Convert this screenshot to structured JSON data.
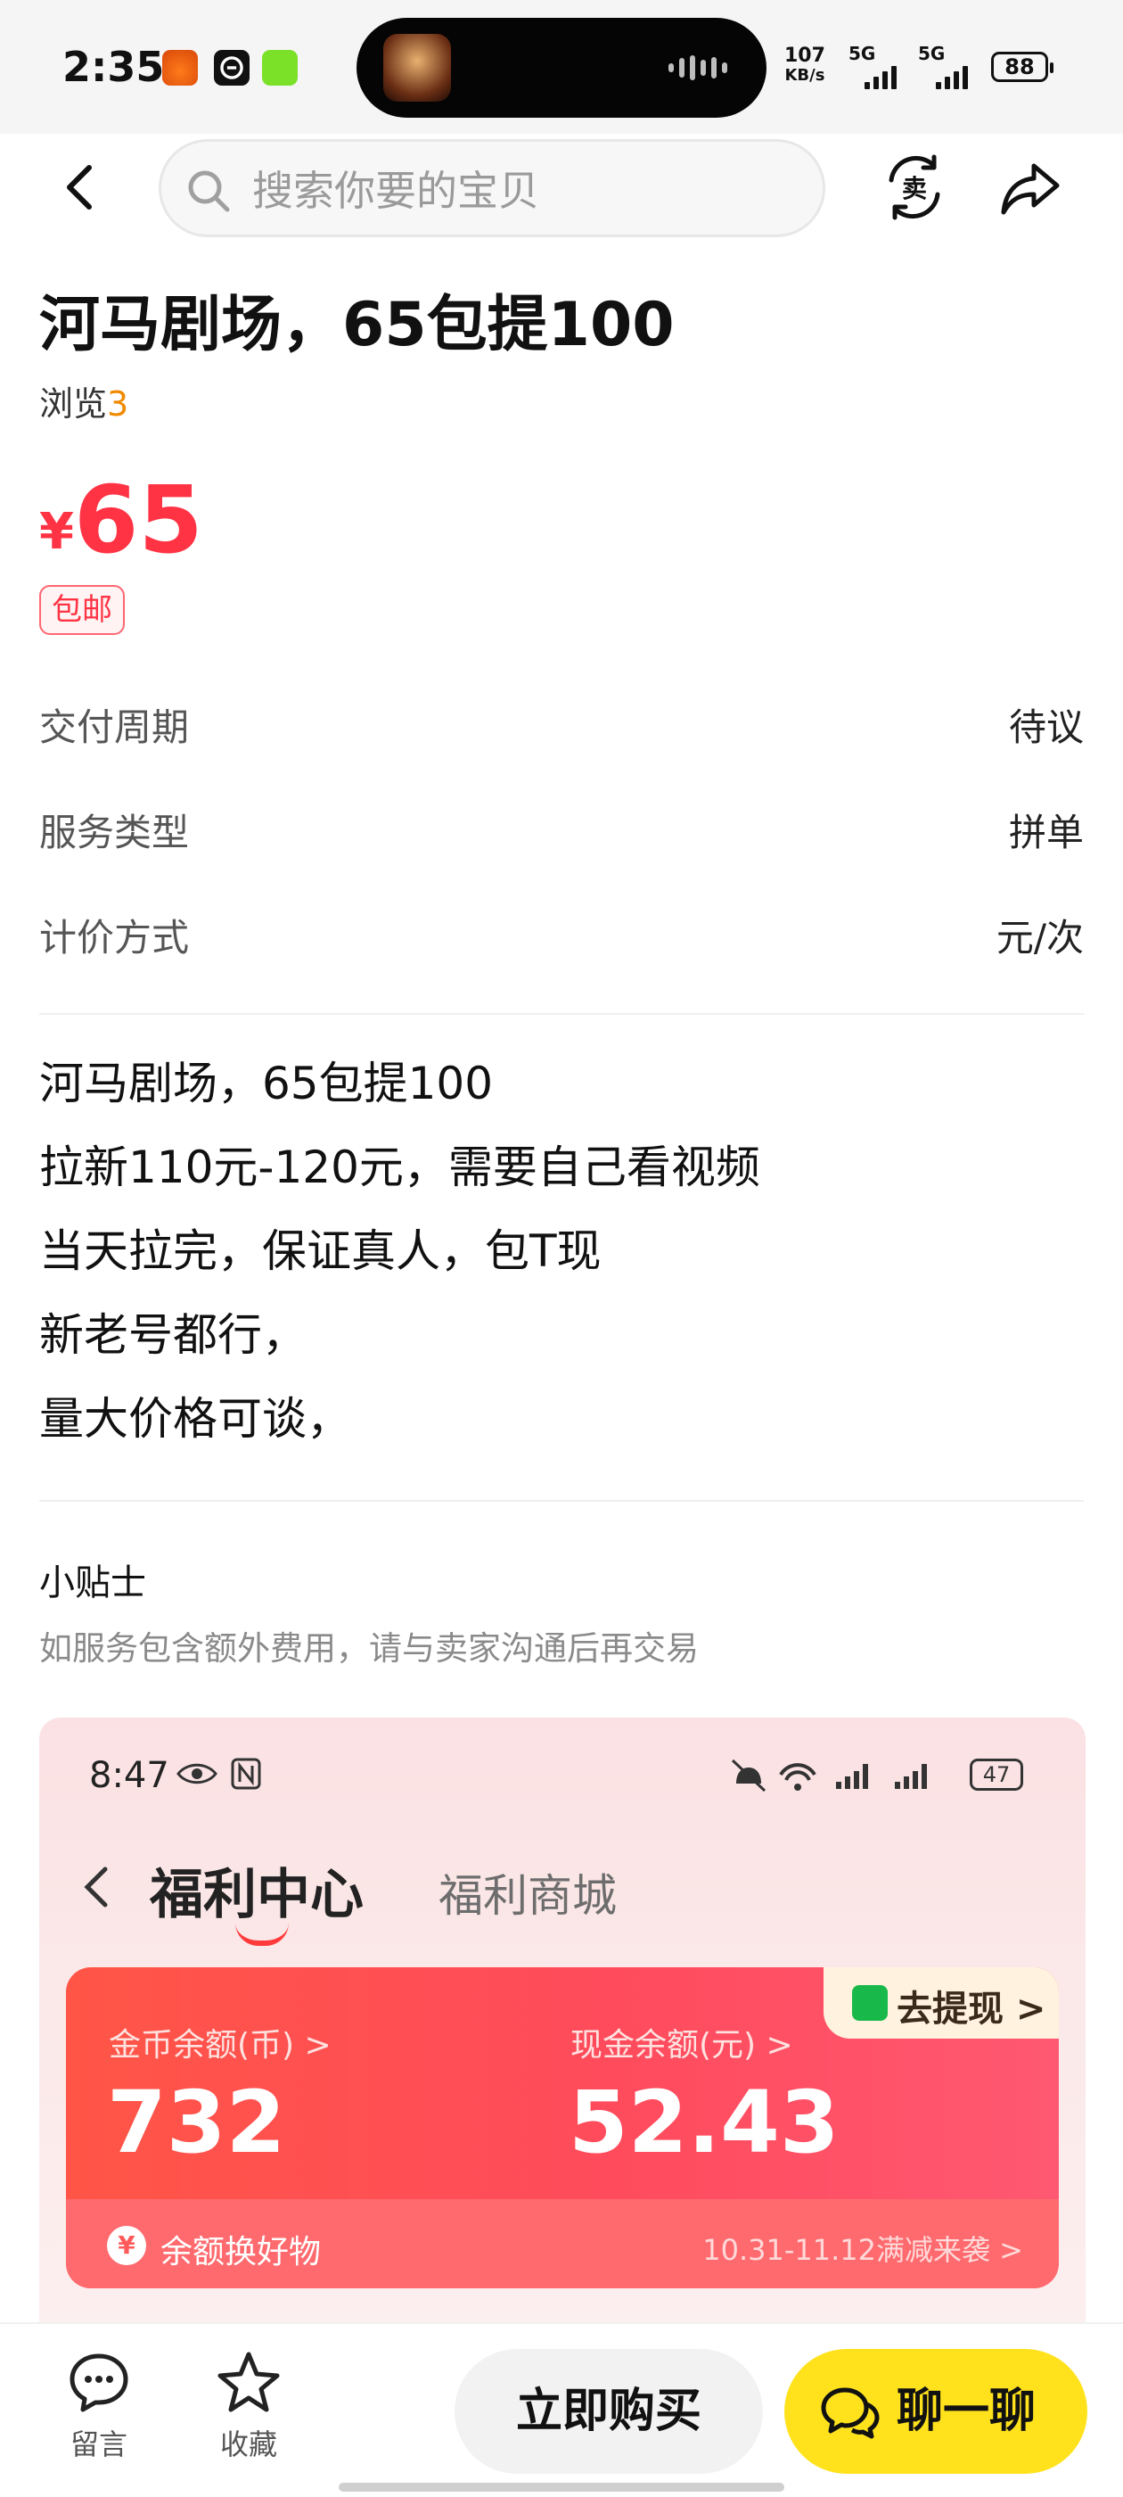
{
  "status_bar": {
    "time": "2:35",
    "network_speed": "107",
    "network_unit": "KB/s",
    "signal_1": "5G",
    "signal_2": "5G",
    "battery": "88"
  },
  "header": {
    "search_placeholder": "搜索你要的宝贝",
    "icons": [
      "back-icon",
      "search-icon",
      "sell-icon",
      "share-icon"
    ]
  },
  "item": {
    "title": "河马剧场，65包提100",
    "views_label": "浏览",
    "views_count": "3",
    "price_symbol": "¥",
    "price": "65",
    "tag": "包邮",
    "price_color": "#ff3344"
  },
  "attributes": [
    {
      "key": "交付周期",
      "value": "待议"
    },
    {
      "key": "服务类型",
      "value": "拼单"
    },
    {
      "key": "计价方式",
      "value": "元/次"
    }
  ],
  "description": [
    "河马剧场，65包提100",
    "拉新110元-120元，需要自己看视频",
    "当天拉完，保证真人，包T现",
    "新老号都行，",
    "量大价格可谈，"
  ],
  "tips": {
    "title": "小贴士",
    "text": "如服务包含额外费用，请与卖家沟通后再交易"
  },
  "embedded_screenshot": {
    "time": "8:47",
    "battery": "47",
    "tab_active": "福利中心",
    "tab_other": "福利商城",
    "withdraw_button": "去提现 >",
    "coin_label": "金币余额(币) >",
    "coin_value": "732",
    "cash_label": "现金余额(元) >",
    "cash_value": "52.43",
    "footer_icon": "¥",
    "footer_text": "余额换好物",
    "footer_promo": "10.31-11.12满减来袭 >"
  },
  "bottom_bar": {
    "message_label": "留言",
    "favorite_label": "收藏",
    "buy_label": "立即购买",
    "chat_label": "聊一聊",
    "chat_color": "#ffe21c"
  }
}
